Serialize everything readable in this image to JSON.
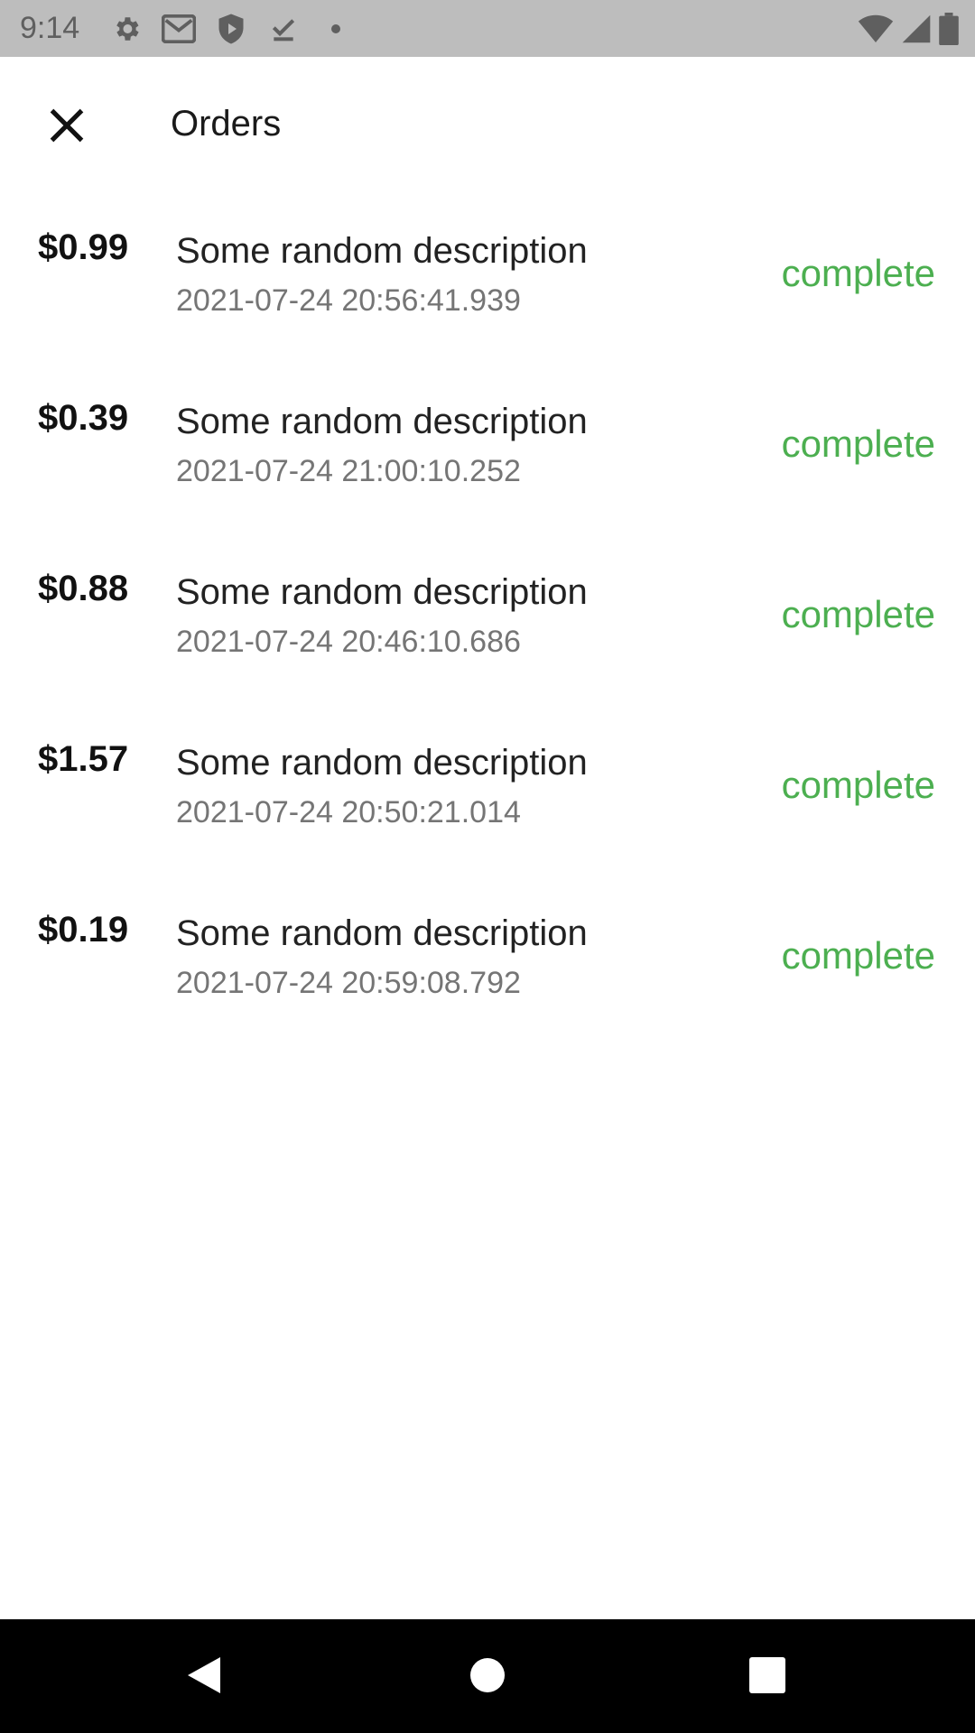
{
  "status_bar": {
    "time": "9:14",
    "left_icons": [
      "gear-icon",
      "gmail-icon",
      "shield-icon",
      "download-done-icon",
      "dot-icon"
    ],
    "right_icons": [
      "wifi-icon",
      "signal-icon",
      "battery-icon"
    ]
  },
  "app_bar": {
    "title": "Orders",
    "close_icon": "close-icon"
  },
  "orders": [
    {
      "amount": "$0.99",
      "description": "Some random description",
      "timestamp": "2021-07-24 20:56:41.939",
      "status": "complete"
    },
    {
      "amount": "$0.39",
      "description": "Some random description",
      "timestamp": "2021-07-24 21:00:10.252",
      "status": "complete"
    },
    {
      "amount": "$0.88",
      "description": "Some random description",
      "timestamp": "2021-07-24 20:46:10.686",
      "status": "complete"
    },
    {
      "amount": "$1.57",
      "description": "Some random description",
      "timestamp": "2021-07-24 20:50:21.014",
      "status": "complete"
    },
    {
      "amount": "$0.19",
      "description": "Some random description",
      "timestamp": "2021-07-24 20:59:08.792",
      "status": "complete"
    }
  ],
  "colors": {
    "status_complete": "#4caf50",
    "status_bar_bg": "#bdbdbd",
    "nav_bar_bg": "#000000"
  },
  "nav_bar": {
    "icons": [
      "back-icon",
      "home-icon",
      "recents-icon"
    ]
  }
}
